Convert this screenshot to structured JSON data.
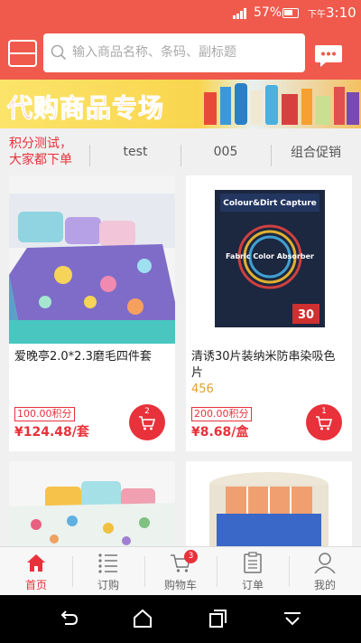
{
  "status_bar": {
    "battery_pct": "57%",
    "time_prefix": "下午",
    "time": "3:10"
  },
  "header": {
    "search_placeholder": "输入商品名称、条码、副标题"
  },
  "banner": {
    "title": "代购商品专场"
  },
  "categories": [
    {
      "label": "积分测试，大家都下单",
      "active": true
    },
    {
      "label": "test",
      "active": false
    },
    {
      "label": "005",
      "active": false
    },
    {
      "label": "组合促销",
      "active": false
    }
  ],
  "products": [
    {
      "name": "爱晚亭2.0*2.3磨毛四件套",
      "code": "",
      "points": "100.00积分",
      "price": "¥124.48/套",
      "cart_count": "2"
    },
    {
      "name": "清诱30片装纳米防串染吸色片",
      "code": "456",
      "points": "200.00积分",
      "price": "¥8.68/盒",
      "cart_count": "1",
      "box_text_1": "Colour&Dirt Capture",
      "box_text_2": "Fabric Color Absorber",
      "box_number": "30"
    }
  ],
  "tabbar": {
    "items": [
      {
        "label": "首页",
        "icon": "home-icon",
        "active": true
      },
      {
        "label": "订购",
        "icon": "list-icon",
        "active": false
      },
      {
        "label": "购物车",
        "icon": "cart-icon",
        "active": false,
        "badge": "3"
      },
      {
        "label": "订单",
        "icon": "order-icon",
        "active": false
      },
      {
        "label": "我的",
        "icon": "user-icon",
        "active": false
      }
    ]
  },
  "colors": {
    "accent": "#ef5a4c",
    "price_red": "#e8313a",
    "code_orange": "#e0a030"
  }
}
